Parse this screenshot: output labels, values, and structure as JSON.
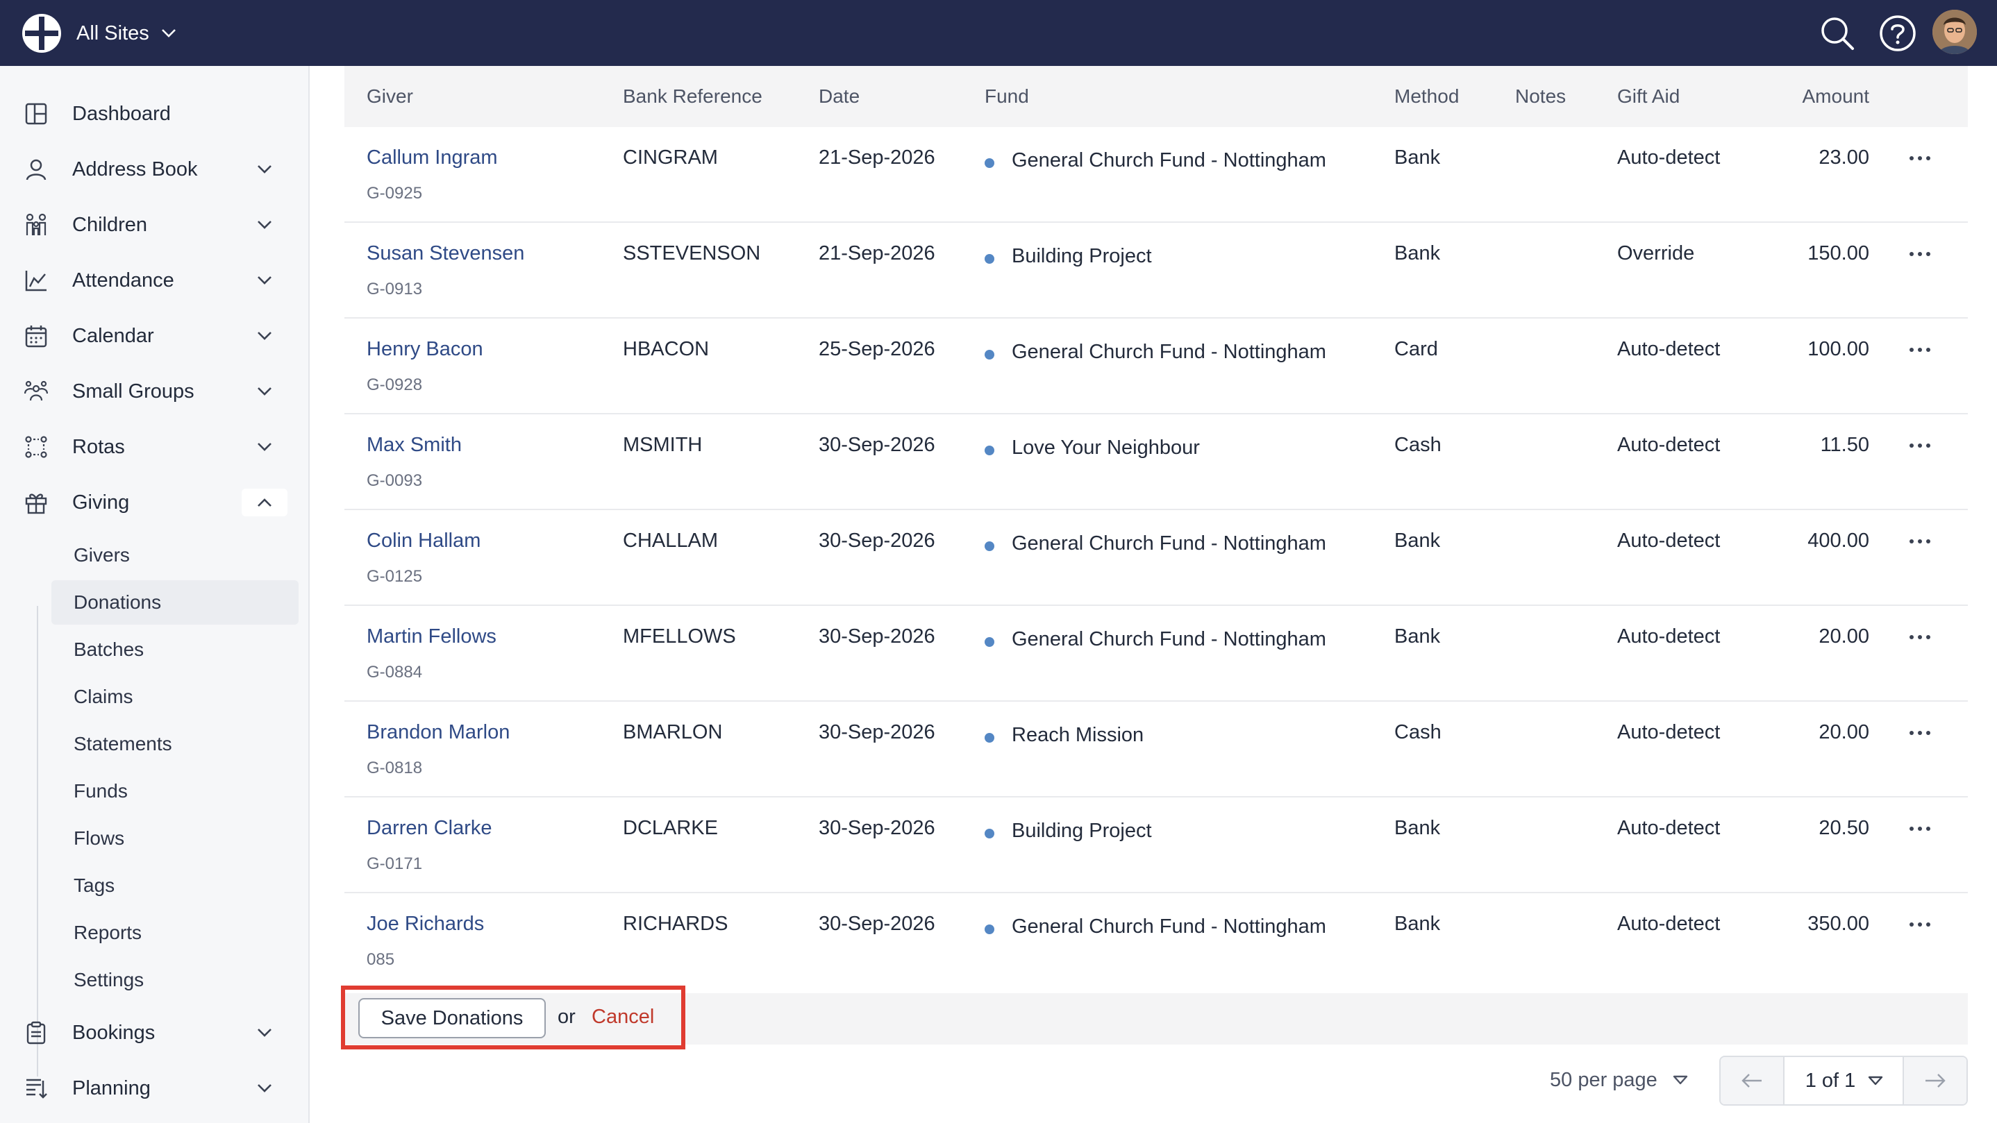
{
  "topbar": {
    "site_switcher": "All Sites",
    "search_icon": "search-icon",
    "help_icon": "help-icon",
    "avatar_icon": "user-avatar"
  },
  "sidebar": {
    "items": [
      {
        "label": "Dashboard",
        "icon": "dashboard-icon",
        "has_chevron": false
      },
      {
        "label": "Address Book",
        "icon": "person-icon",
        "has_chevron": true
      },
      {
        "label": "Children",
        "icon": "children-icon",
        "has_chevron": true
      },
      {
        "label": "Attendance",
        "icon": "chart-icon",
        "has_chevron": true
      },
      {
        "label": "Calendar",
        "icon": "calendar-icon",
        "has_chevron": true
      },
      {
        "label": "Small Groups",
        "icon": "group-icon",
        "has_chevron": true
      },
      {
        "label": "Rotas",
        "icon": "rotas-icon",
        "has_chevron": true
      },
      {
        "label": "Giving",
        "icon": "gift-icon",
        "has_chevron": true,
        "expanded": true
      },
      {
        "label": "Bookings",
        "icon": "clipboard-icon",
        "has_chevron": true
      },
      {
        "label": "Planning",
        "icon": "planning-icon",
        "has_chevron": true
      }
    ],
    "giving_sub": [
      "Givers",
      "Donations",
      "Batches",
      "Claims",
      "Statements",
      "Funds",
      "Flows",
      "Tags",
      "Reports",
      "Settings"
    ],
    "active_sub": "Donations"
  },
  "table": {
    "headers": {
      "giver": "Giver",
      "bank_ref": "Bank Reference",
      "date": "Date",
      "fund": "Fund",
      "method": "Method",
      "notes": "Notes",
      "gift_aid": "Gift Aid",
      "amount": "Amount"
    },
    "rows": [
      {
        "name": "Callum Ingram",
        "id": "G-0925",
        "ref": "CINGRAM",
        "date": "21-Sep-2026",
        "fund": "General Church Fund - Nottingham",
        "method": "Bank",
        "notes": "",
        "gift_aid": "Auto-detect",
        "amount": "23.00"
      },
      {
        "name": "Susan Stevensen",
        "id": "G-0913",
        "ref": "SSTEVENSON",
        "date": "21-Sep-2026",
        "fund": "Building Project",
        "method": "Bank",
        "notes": "",
        "gift_aid": "Override",
        "amount": "150.00"
      },
      {
        "name": "Henry Bacon",
        "id": "G-0928",
        "ref": "HBACON",
        "date": "25-Sep-2026",
        "fund": "General Church Fund - Nottingham",
        "method": "Card",
        "notes": "",
        "gift_aid": "Auto-detect",
        "amount": "100.00"
      },
      {
        "name": "Max Smith",
        "id": "G-0093",
        "ref": "MSMITH",
        "date": "30-Sep-2026",
        "fund": "Love Your Neighbour",
        "method": "Cash",
        "notes": "",
        "gift_aid": "Auto-detect",
        "amount": "11.50"
      },
      {
        "name": "Colin Hallam",
        "id": "G-0125",
        "ref": "CHALLAM",
        "date": "30-Sep-2026",
        "fund": "General Church Fund - Nottingham",
        "method": "Bank",
        "notes": "",
        "gift_aid": "Auto-detect",
        "amount": "400.00"
      },
      {
        "name": "Martin Fellows",
        "id": "G-0884",
        "ref": "MFELLOWS",
        "date": "30-Sep-2026",
        "fund": "General Church Fund - Nottingham",
        "method": "Bank",
        "notes": "",
        "gift_aid": "Auto-detect",
        "amount": "20.00"
      },
      {
        "name": "Brandon Marlon",
        "id": "G-0818",
        "ref": "BMARLON",
        "date": "30-Sep-2026",
        "fund": "Reach Mission",
        "method": "Cash",
        "notes": "",
        "gift_aid": "Auto-detect",
        "amount": "20.00"
      },
      {
        "name": "Darren Clarke",
        "id": "G-0171",
        "ref": "DCLARKE",
        "date": "30-Sep-2026",
        "fund": "Building Project",
        "method": "Bank",
        "notes": "",
        "gift_aid": "Auto-detect",
        "amount": "20.50"
      },
      {
        "name": "Joe Richards",
        "id": "085",
        "ref": "RICHARDS",
        "date": "30-Sep-2026",
        "fund": "General Church Fund - Nottingham",
        "method": "Bank",
        "notes": "",
        "gift_aid": "Auto-detect",
        "amount": "350.00"
      }
    ]
  },
  "actions": {
    "save_label": "Save Donations",
    "or_text": "or",
    "cancel_label": "Cancel"
  },
  "pagination": {
    "per_page": "50 per page",
    "page_label": "1 of 1"
  },
  "colors": {
    "topbar": "#232a4d",
    "link": "#2f4a86",
    "fund_dot": "#5487c4",
    "cancel": "#c0392b",
    "highlight": "#e03c31"
  }
}
